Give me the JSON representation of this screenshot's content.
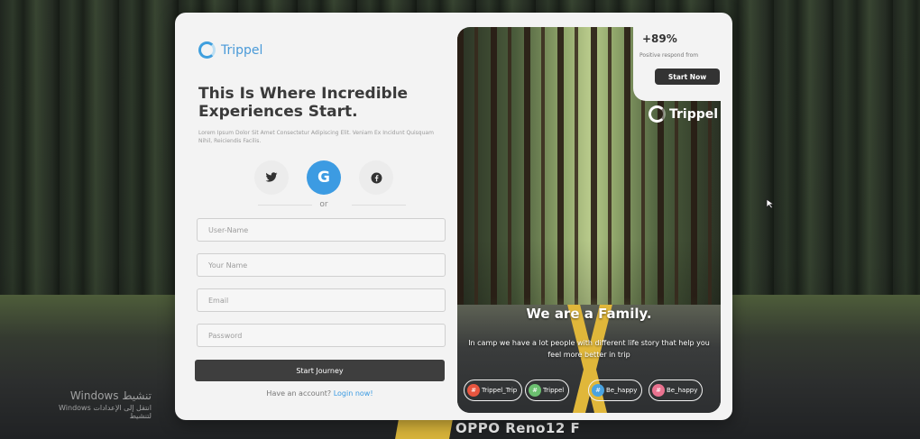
{
  "brand": {
    "name": "Trippel",
    "accent": "#3c9be2"
  },
  "form": {
    "headline": "This Is Where Incredible Experiences Start.",
    "description": "Lorem Ipsum Dolor Sit Amet Consectetur Adipiscing Elit. Veniam Ex Incidunt Quisquam Nihil, Reiciendis Facilis.",
    "social": [
      {
        "icon": "twitter-icon"
      },
      {
        "icon": "google-icon",
        "glyph": "G"
      },
      {
        "icon": "facebook-icon"
      }
    ],
    "or_label": "or",
    "fields": {
      "username_placeholder": "User-Name",
      "yourname_placeholder": "Your Name",
      "email_placeholder": "Email",
      "password_placeholder": "Password"
    },
    "submit_label": "Start Journey",
    "account_prompt": "Have an account?",
    "login_link": "Login now!"
  },
  "promo": {
    "stat_value": "+89%",
    "stat_caption": "Positive respond from",
    "cta_label": "Start Now",
    "brand": "Trippel",
    "title": "We are a Family.",
    "text": "In camp we have a lot people with different life story that help you feel more better in trip",
    "tags": [
      {
        "symbol": "#",
        "label": "Trippel_Trip",
        "color": "#e8553f"
      },
      {
        "symbol": "#",
        "label": "Trippel",
        "color": "#6cc070"
      },
      {
        "symbol": "#",
        "label": "Be_happy",
        "color": "#4aa3e0"
      },
      {
        "symbol": "#",
        "label": "Be_happy",
        "color": "#e9728f"
      }
    ]
  },
  "watermark": {
    "line1": "Windows تنشيط",
    "line2": "Windows انتقل إلى الإعدادات لتنشيط"
  },
  "phone_mark": "OPPO Reno12 F"
}
